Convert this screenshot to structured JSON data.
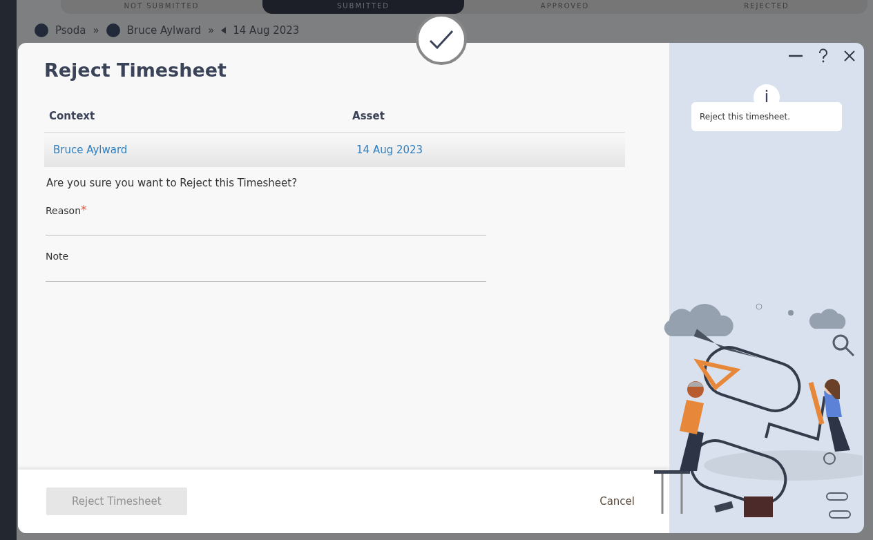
{
  "background": {
    "tabs": [
      {
        "label": "NOT SUBMITTED",
        "selected": false
      },
      {
        "label": "SUBMITTED",
        "selected": true
      },
      {
        "label": "APPROVED",
        "selected": false
      },
      {
        "label": "REJECTED",
        "selected": false
      }
    ],
    "breadcrumb": {
      "separator": "»",
      "items": [
        "Psoda",
        "Bruce Aylward",
        "14 Aug 2023"
      ]
    }
  },
  "dialog": {
    "title": "Reject Timesheet",
    "table": {
      "columns": [
        "Context",
        "Asset"
      ],
      "rows": [
        [
          "Bruce Aylward",
          "14 Aug 2023"
        ]
      ]
    },
    "question": "Are you sure you want to Reject this Timesheet?",
    "required_marker": "*",
    "fields": [
      {
        "label": "Reason",
        "required": true
      },
      {
        "label": "Note",
        "required": false
      }
    ],
    "submit": {
      "label": "Reject Timesheet",
      "disabled": true
    },
    "cancel": {
      "label": "Cancel"
    }
  },
  "help": {
    "info_glyph": "i",
    "tip": "Reject this timesheet."
  }
}
